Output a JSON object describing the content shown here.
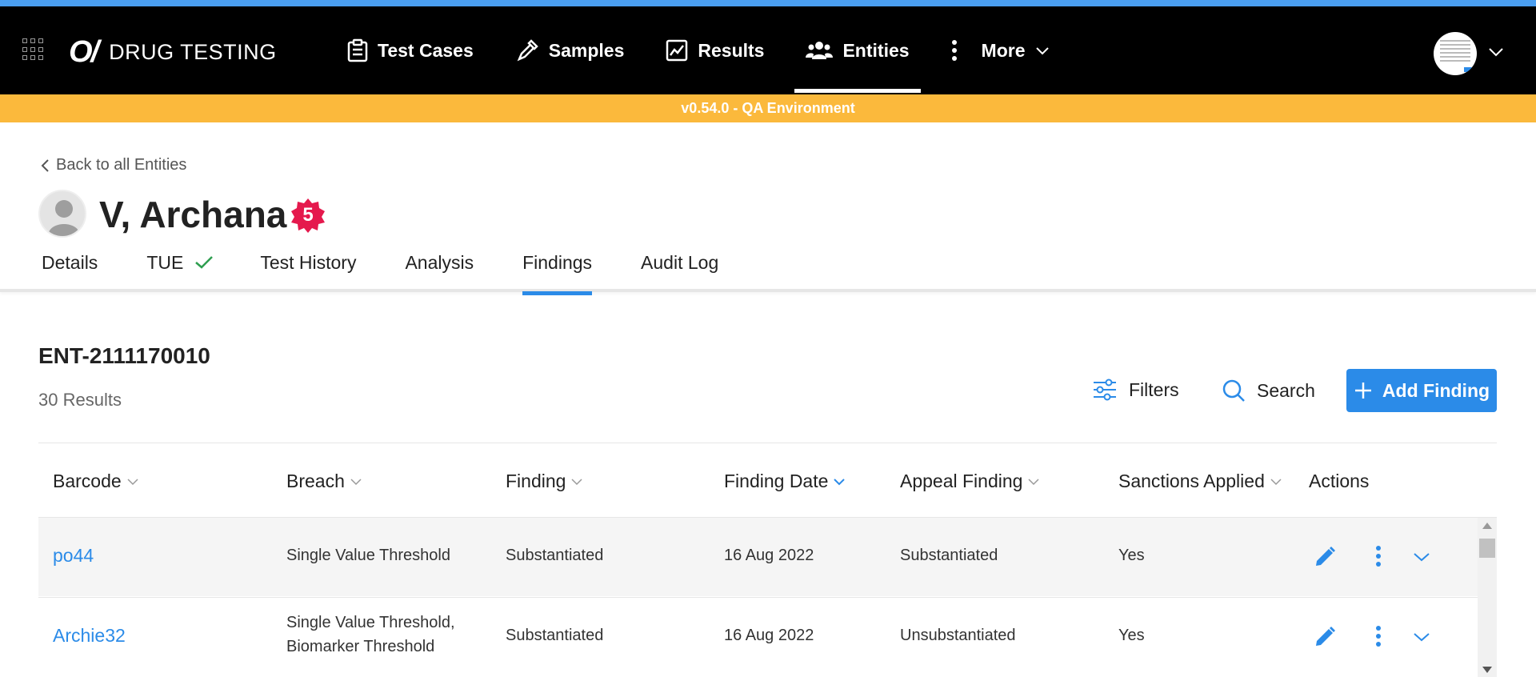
{
  "app": {
    "logo": "O/",
    "title": "DRUG TESTING"
  },
  "nav": {
    "items": [
      {
        "label": "Test Cases",
        "icon": "clipboard-icon"
      },
      {
        "label": "Samples",
        "icon": "pipette-icon"
      },
      {
        "label": "Results",
        "icon": "chart-icon"
      },
      {
        "label": "Entities",
        "icon": "users-icon",
        "active": true
      },
      {
        "label": "More",
        "icon": "kebab-icon"
      }
    ]
  },
  "env_banner": "v0.54.0 - QA Environment",
  "header": {
    "back_label": "Back to all Entities",
    "name": "V, Archana",
    "badge_count": "5",
    "tabs": [
      {
        "label": "Details"
      },
      {
        "label": "TUE",
        "icon": "check-icon"
      },
      {
        "label": "Test History"
      },
      {
        "label": "Analysis"
      },
      {
        "label": "Findings",
        "active": true
      },
      {
        "label": "Audit Log"
      }
    ]
  },
  "content": {
    "entity_id": "ENT-2111170010",
    "results_count": "30 Results",
    "filters_label": "Filters",
    "search_label": "Search",
    "add_label": "Add Finding"
  },
  "table": {
    "columns": [
      "Barcode",
      "Breach",
      "Finding",
      "Finding Date",
      "Appeal Finding",
      "Sanctions Applied",
      "Actions"
    ],
    "rows": [
      {
        "barcode": "po44",
        "breach": "Single Value Threshold",
        "finding": "Substantiated",
        "finding_date": "16 Aug 2022",
        "appeal_finding": "Substantiated",
        "sanctions": "Yes"
      },
      {
        "barcode": "Archie32",
        "breach": "Single Value Threshold, Biomarker Threshold",
        "finding": "Substantiated",
        "finding_date": "16 Aug 2022",
        "appeal_finding": "Unsubstantiated",
        "sanctions": "Yes"
      }
    ]
  },
  "colors": {
    "accent": "#2b8be8",
    "env_bar": "#fbb93c",
    "badge": "#e5194d",
    "check": "#2e9e4f"
  }
}
